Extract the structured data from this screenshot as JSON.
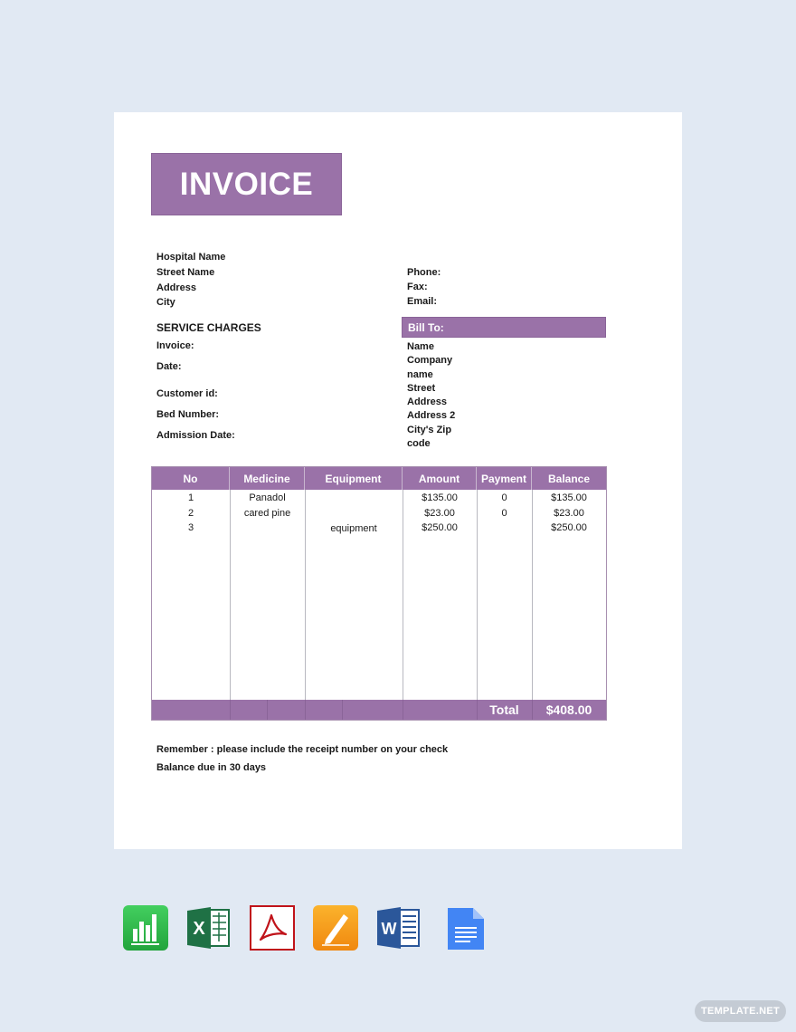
{
  "invoice": {
    "title": "INVOICE",
    "hospital": [
      "Hospital Name",
      "Street Name",
      "Address",
      "City"
    ],
    "contact": [
      "Phone:",
      "Fax:",
      "Email:"
    ],
    "service_charges": "SERVICE CHARGES",
    "fields": [
      "Invoice:",
      "Date:",
      "Customer id:",
      "Bed Number:",
      "Admission Date:"
    ],
    "bill_to": {
      "label": "Bill To:",
      "lines": [
        "Name",
        "Company",
        "name",
        "Street",
        "Address",
        "Address 2",
        "City's Zip",
        "code"
      ]
    },
    "table": {
      "headers": [
        "No",
        "Medicine",
        "Equipment",
        "Amount",
        "Payment",
        "Balance"
      ],
      "rows": [
        {
          "no": "1",
          "medicine": "Panadol",
          "equipment": "",
          "amount": "$135.00",
          "payment": "0",
          "balance": "$135.00"
        },
        {
          "no": "2",
          "medicine": "cared pine",
          "equipment": "",
          "amount": "$23.00",
          "payment": "0",
          "balance": "$23.00"
        },
        {
          "no": "3",
          "medicine": "",
          "equipment": "equipment",
          "amount": "$250.00",
          "payment": "",
          "balance": "$250.00"
        }
      ],
      "total_label": "Total",
      "total_value": "$408.00"
    },
    "notes": [
      "Remember : please include the receipt number on your check",
      "Balance due in 30 days"
    ]
  },
  "formats": [
    {
      "name": "numbers-icon",
      "label": "Numbers",
      "color": "#2fb54a"
    },
    {
      "name": "excel-icon",
      "label": "Excel",
      "color": "#1f7145"
    },
    {
      "name": "pdf-icon",
      "label": "Acrobat PDF",
      "color": "#c0131a"
    },
    {
      "name": "pages-icon",
      "label": "Pages",
      "color": "#f6a01b"
    },
    {
      "name": "word-icon",
      "label": "Word",
      "color": "#2b579a"
    },
    {
      "name": "google-docs-icon",
      "label": "Google Docs",
      "color": "#4285f4"
    }
  ],
  "watermark": "TEMPLATE.NET",
  "colors": {
    "accent": "#9a72a8",
    "background": "#e1e9f3"
  }
}
